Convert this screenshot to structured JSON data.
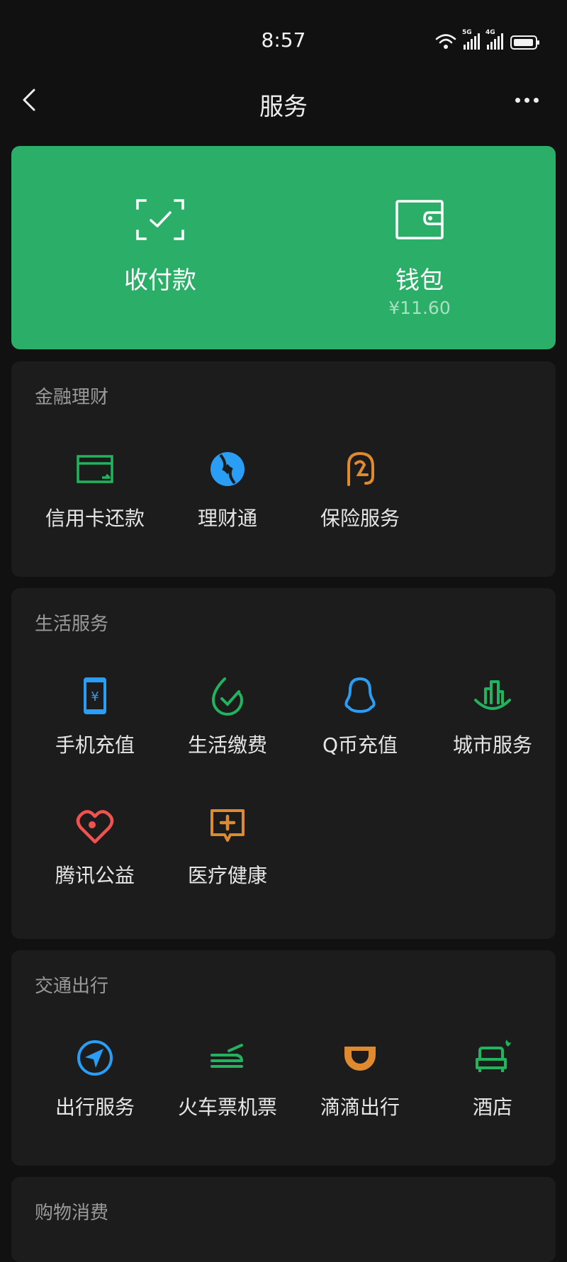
{
  "status_bar": {
    "time": "8:57",
    "sig1_label": "5G",
    "sig2_label": "4G"
  },
  "header": {
    "title": "服务"
  },
  "pay_card": {
    "receive_pay": {
      "label": "收付款"
    },
    "wallet": {
      "label": "钱包",
      "balance": "¥11.60"
    }
  },
  "sections": {
    "finance": {
      "title": "金融理财",
      "items": [
        {
          "label": "信用卡还款",
          "icon": "credit-card-icon",
          "color": "#21b35e"
        },
        {
          "label": "理财通",
          "icon": "wealth-icon",
          "color": "#2a9ef4"
        },
        {
          "label": "保险服务",
          "icon": "insurance-icon",
          "color": "#e08a30"
        }
      ]
    },
    "life": {
      "title": "生活服务",
      "items": [
        {
          "label": "手机充值",
          "icon": "phone-topup-icon",
          "color": "#2a9ef4"
        },
        {
          "label": "生活缴费",
          "icon": "utility-bill-icon",
          "color": "#21b35e"
        },
        {
          "label": "Q币充值",
          "icon": "qq-penguin-icon",
          "color": "#2a9ef4"
        },
        {
          "label": "城市服务",
          "icon": "city-service-icon",
          "color": "#21b35e"
        },
        {
          "label": "腾讯公益",
          "icon": "charity-heart-icon",
          "color": "#f0524f"
        },
        {
          "label": "医疗健康",
          "icon": "medical-icon",
          "color": "#e08a30"
        }
      ]
    },
    "transport": {
      "title": "交通出行",
      "items": [
        {
          "label": "出行服务",
          "icon": "navigation-icon",
          "color": "#2a9ef4"
        },
        {
          "label": "火车票机票",
          "icon": "train-plane-icon",
          "color": "#21b35e"
        },
        {
          "label": "滴滴出行",
          "icon": "didi-icon",
          "color": "#e08a30"
        },
        {
          "label": "酒店",
          "icon": "hotel-bed-icon",
          "color": "#21b35e"
        }
      ]
    },
    "shopping": {
      "title": "购物消费"
    }
  }
}
